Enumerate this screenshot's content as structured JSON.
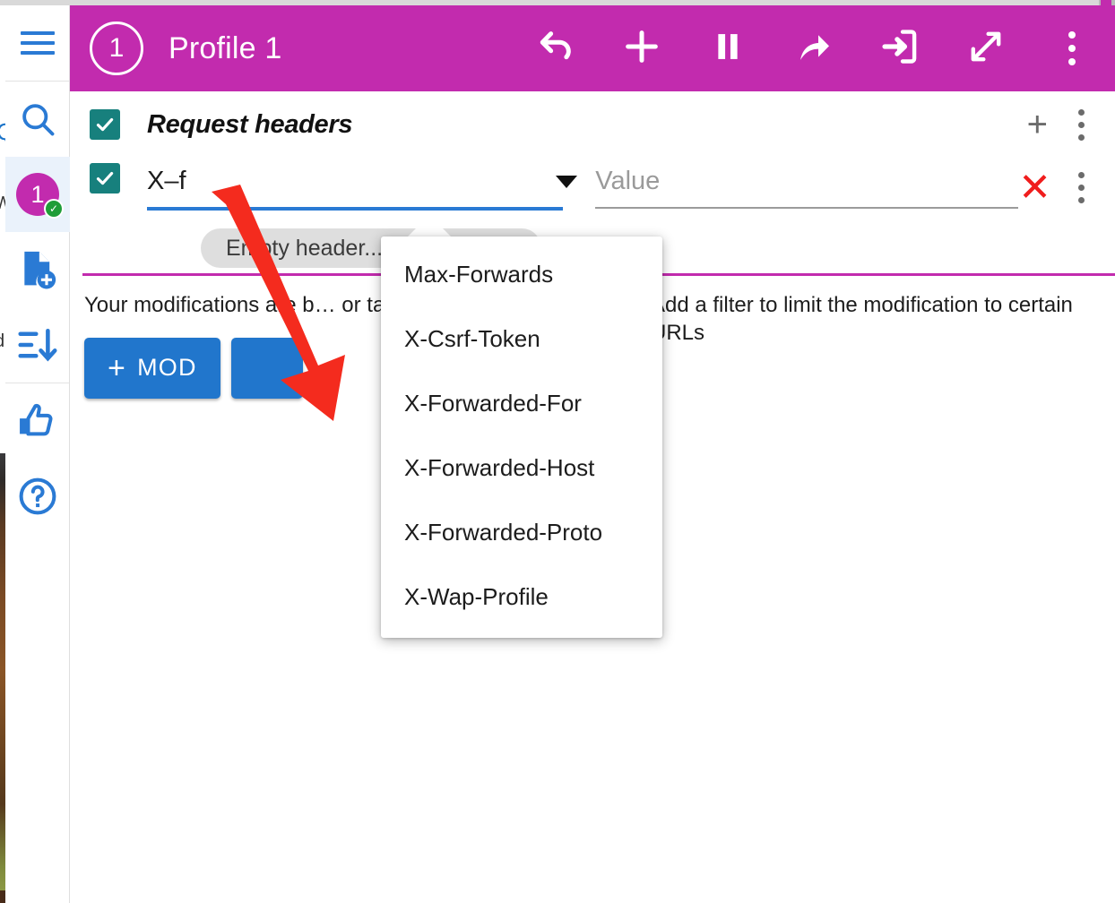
{
  "app": {
    "profile_number": "1",
    "title": "Profile 1",
    "accent_color": "#C22BAE",
    "blue_color": "#2176CC",
    "teal_color": "#17807D",
    "red_color": "#F01D1D"
  },
  "rail": {
    "items": [
      {
        "name": "menu",
        "icon": "hamburger-icon",
        "label": ""
      },
      {
        "name": "search",
        "icon": "search-icon",
        "label": ""
      },
      {
        "name": "profile",
        "icon": "profile-badge-icon",
        "label": "1",
        "active": true
      },
      {
        "name": "new-profile",
        "icon": "new-document-icon",
        "label": ""
      },
      {
        "name": "sort",
        "icon": "sort-descending-icon",
        "label": ""
      },
      {
        "name": "rate",
        "icon": "thumbs-up-icon",
        "label": ""
      },
      {
        "name": "help",
        "icon": "help-circle-icon",
        "label": ""
      }
    ]
  },
  "toolbar": {
    "buttons": [
      {
        "name": "undo",
        "icon": "undo-icon"
      },
      {
        "name": "add",
        "icon": "plus-icon"
      },
      {
        "name": "pause",
        "icon": "pause-icon"
      },
      {
        "name": "export",
        "icon": "share-arrow-icon"
      },
      {
        "name": "import",
        "icon": "import-login-icon"
      },
      {
        "name": "expand",
        "icon": "expand-diagonal-icon"
      },
      {
        "name": "more",
        "icon": "more-vertical-icon"
      }
    ]
  },
  "section": {
    "enabled": true,
    "title": "Request headers",
    "add_icon": "plus-icon",
    "more_icon": "more-vertical-icon"
  },
  "header_row": {
    "enabled": true,
    "name_value": "X–f",
    "name_dropdown_icon": "caret-down-icon",
    "value_placeholder": "Value",
    "value_value": "",
    "delete_icon": "close-x-icon",
    "more_icon": "more-vertical-icon"
  },
  "chip": {
    "text": "Empty header...",
    "close_icon": "chip-close-icon"
  },
  "autocomplete": {
    "options": [
      "Max-Forwards",
      "X-Csrf-Token",
      "X-Forwarded-For",
      "X-Forwarded-Host",
      "X-Forwarded-Proto",
      "X-Wap-Profile"
    ]
  },
  "body": {
    "left_text": "Your modifications are b… or tabs.",
    "right_text": "Add a filter to limit the modification to certain URLs",
    "buttons": [
      {
        "name": "add-mod",
        "plus": "+",
        "label": "MOD"
      },
      {
        "name": "add-filter",
        "plus": "",
        "label": ""
      }
    ]
  },
  "annotation": {
    "arrow_color": "#F42B1E",
    "from": "235,220",
    "to": "366,456"
  }
}
